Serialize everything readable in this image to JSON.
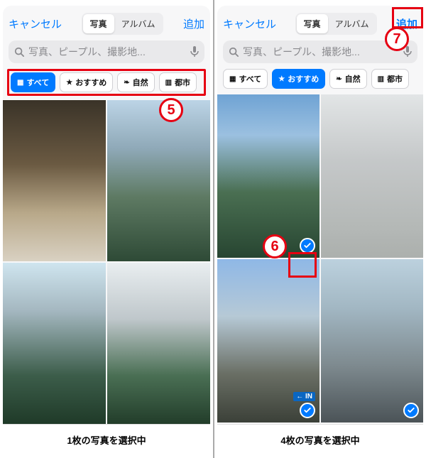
{
  "colors": {
    "accent": "#007aff",
    "marker": "#e60012"
  },
  "left": {
    "cancel": "キャンセル",
    "add": "追加",
    "seg": {
      "photos": "写真",
      "albums": "アルバム"
    },
    "search": {
      "placeholder": "写真、ピープル、撮影地..."
    },
    "filters": {
      "all": "すべて",
      "featured": "おすすめ",
      "nature": "自然",
      "city": "都市"
    },
    "footer": "1枚の写真を選択中"
  },
  "right": {
    "cancel": "キャンセル",
    "add": "追加",
    "seg": {
      "photos": "写真",
      "albums": "アルバム"
    },
    "search": {
      "placeholder": "写真、ピープル、撮影地..."
    },
    "filters": {
      "all": "すべて",
      "featured": "おすすめ",
      "nature": "自然",
      "city": "都市"
    },
    "footer": "4枚の写真を選択中",
    "in_sign": "← IN"
  },
  "markers": {
    "m5": "5",
    "m6": "6",
    "m7": "7"
  },
  "icons": {
    "search": "search-icon",
    "mic": "mic-icon",
    "grid": "grid-icon",
    "star": "star-icon",
    "leaf": "leaf-icon",
    "city": "city-icon",
    "check": "checkmark-icon"
  }
}
